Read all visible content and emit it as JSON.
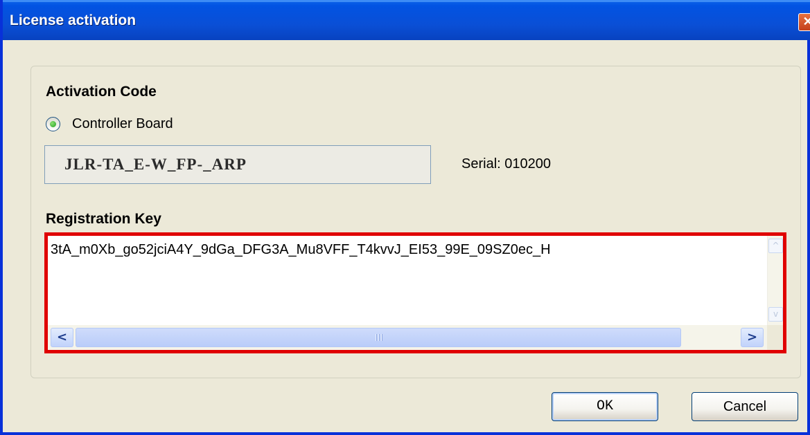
{
  "window": {
    "title": "License activation",
    "close_glyph": "✕"
  },
  "activation": {
    "heading": "Activation Code",
    "radio_label": "Controller Board",
    "radio_selected": true,
    "code": "JLR-TA_E-W_FP-_ARP",
    "serial_text": "Serial: 010200"
  },
  "registration": {
    "heading": "Registration Key",
    "key": "3tA_m0Xb_go52jciA4Y_9dGa_DFG3A_Mu8VFF_T4kvvJ_EI53_99E_09SZ0ec_H",
    "grip_glyph": "|||"
  },
  "scroll_glyphs": {
    "left": "<",
    "right": ">",
    "up": "^",
    "down": "v"
  },
  "buttons": {
    "ok": "OK",
    "cancel": "Cancel"
  },
  "colors": {
    "title_bar": "#0a4fd6",
    "window_bg": "#ece9d8",
    "highlight_border": "#e00000"
  },
  "icons": [
    "close-icon",
    "radio-selected-icon",
    "scroll-left-icon",
    "scroll-right-icon",
    "scroll-up-icon",
    "scroll-down-icon"
  ]
}
